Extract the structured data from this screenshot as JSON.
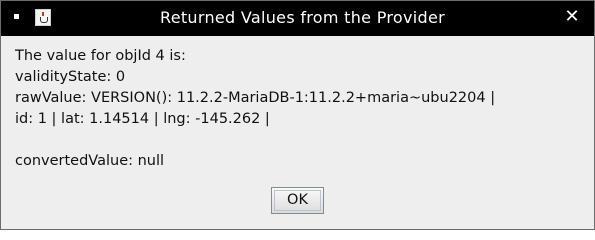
{
  "window": {
    "title": "Returned Values from the Provider",
    "close_glyph": "✕"
  },
  "message": {
    "lines": [
      "The value for objId 4 is:",
      "validityState: 0",
      "rawValue: VERSION(): 11.2.2-MariaDB-1:11.2.2+maria~ubu2204 |",
      "id: 1 | lat: 1.14514 | lng: -145.262 |",
      "",
      "convertedValue: null"
    ]
  },
  "buttons": {
    "ok_label": "OK"
  },
  "icons": {
    "system_menu": "window-menu-icon",
    "app": "java-app-icon",
    "close": "close-icon"
  },
  "colors": {
    "titlebar_bg": "#000000",
    "titlebar_text": "#ffffff",
    "dialog_bg": "#eeeeee"
  }
}
